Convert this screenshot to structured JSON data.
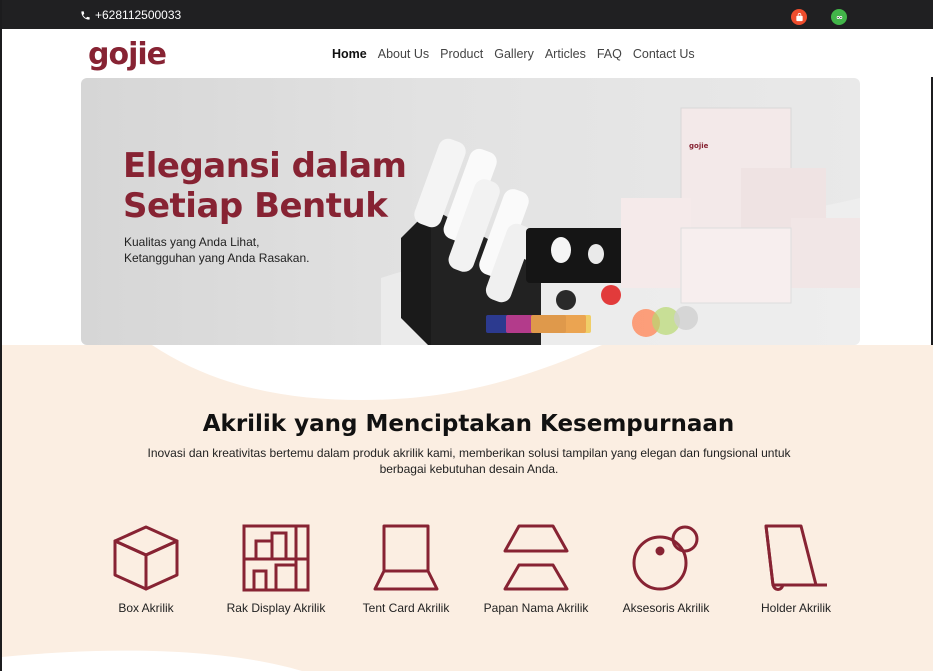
{
  "topbar": {
    "phone": "+628112500033",
    "phone_icon": "phone-icon",
    "shops": [
      "shopee-icon",
      "tokopedia-icon"
    ]
  },
  "nav": {
    "logo": "gojie",
    "items": [
      "Home",
      "About Us",
      "Product",
      "Gallery",
      "Articles",
      "FAQ",
      "Contact Us"
    ],
    "active": "Home"
  },
  "hero": {
    "title": "Elegansi dalam Setiap Bentuk",
    "subtitle_line1": "Kualitas yang Anda Lihat,",
    "subtitle_line2": "Ketangguhan yang Anda Rasakan."
  },
  "section": {
    "title": "Akrilik yang Menciptakan Kesempurnaan",
    "description": "Inovasi dan kreativitas bertemu dalam produk akrilik kami, memberikan solusi tampilan yang elegan dan fungsional untuk berbagai kebutuhan desain Anda."
  },
  "products": [
    {
      "label": "Box Akrilik",
      "icon": "box-icon"
    },
    {
      "label": "Rak Display Akrilik",
      "icon": "shelf-icon"
    },
    {
      "label": "Tent Card Akrilik",
      "icon": "tent-card-icon"
    },
    {
      "label": "Papan Nama Akrilik",
      "icon": "name-plate-icon"
    },
    {
      "label": "Aksesoris Akrilik",
      "icon": "accessory-icon"
    },
    {
      "label": "Holder Akrilik",
      "icon": "holder-icon"
    }
  ],
  "colors": {
    "brand": "#872333",
    "topbar": "#202022",
    "section_bg": "#fbeee2"
  }
}
